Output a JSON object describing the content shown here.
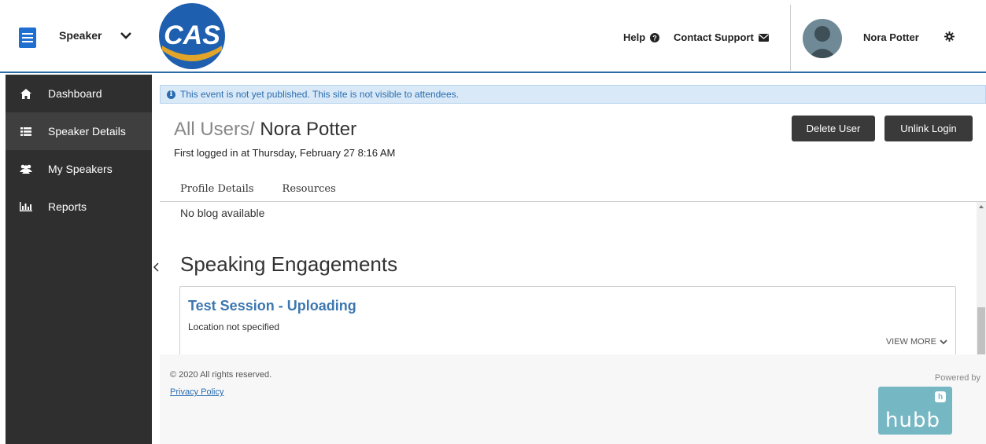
{
  "header": {
    "role_label": "Speaker",
    "logo_text": "CAS",
    "help_label": "Help",
    "contact_label": "Contact Support",
    "user_name": "Nora Potter"
  },
  "sidebar": {
    "items": [
      {
        "label": "Dashboard",
        "icon": "home-icon"
      },
      {
        "label": "Speaker Details",
        "icon": "list-icon"
      },
      {
        "label": "My Speakers",
        "icon": "users-icon"
      },
      {
        "label": "Reports",
        "icon": "bar-chart-icon"
      }
    ]
  },
  "notice": {
    "text": "This event is not yet published. This site is not visible to attendees."
  },
  "page": {
    "crumb": "All Users/",
    "title": "Nora Potter",
    "login_info": "First logged in at Thursday, February 27 8:16 AM",
    "delete_label": "Delete User",
    "unlink_label": "Unlink Login",
    "tabs": [
      {
        "label": "Profile Details",
        "active": true
      },
      {
        "label": "Resources",
        "active": false
      }
    ]
  },
  "content": {
    "blog_text": "No blog available",
    "section_title": "Speaking Engagements",
    "engagement": {
      "title": "Test Session - Uploading",
      "location": "Location not specified",
      "view_more": "VIEW MORE"
    }
  },
  "footer": {
    "copyright": "© 2020 All rights reserved.",
    "privacy": "Privacy Policy",
    "powered_by": "Powered by",
    "hubb_text": "hubb"
  },
  "colors": {
    "accent": "#2b6ba8",
    "sidebar_bg": "#2f2f2f",
    "notice_bg": "#d9e9f7",
    "link": "#3d77b0",
    "hubb": "#76b7c4"
  }
}
